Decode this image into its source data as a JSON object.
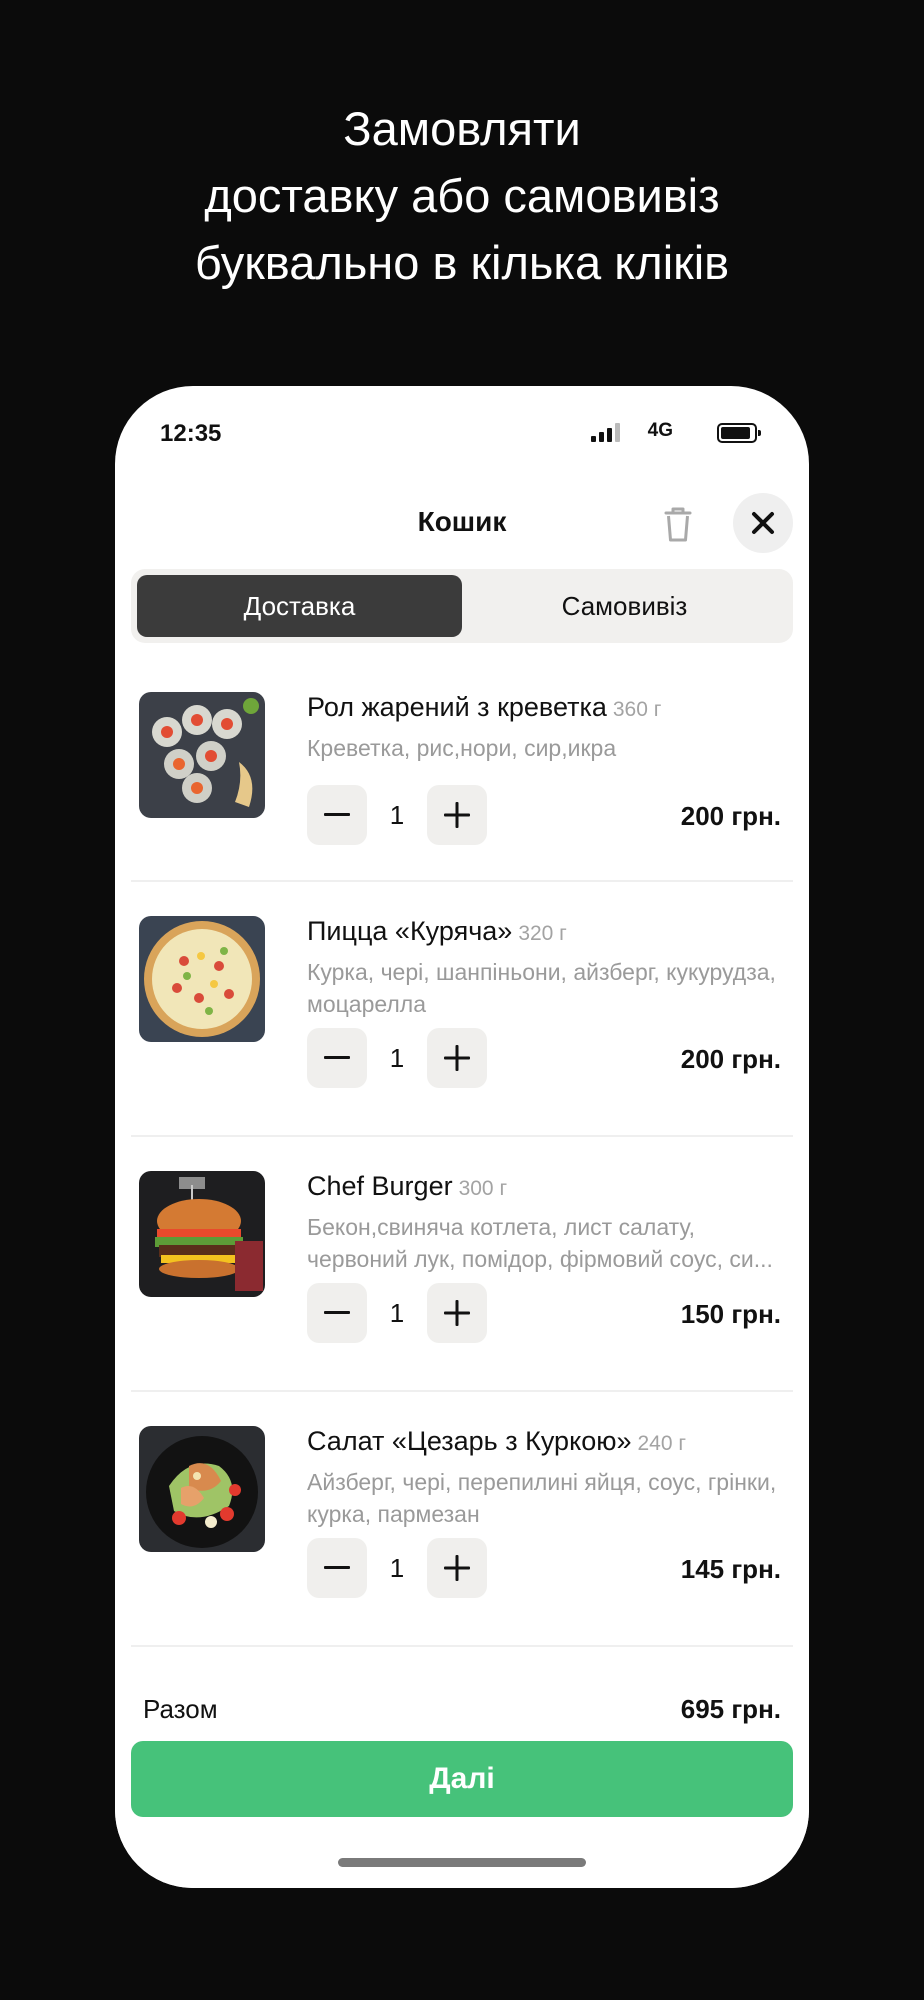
{
  "promo": {
    "line1": "Замовляти",
    "line2": "доставку або самовивіз",
    "line3": "буквально в кілька кліків"
  },
  "status_bar": {
    "time": "12:35",
    "network": "4G"
  },
  "header": {
    "title": "Кошик"
  },
  "tabs": {
    "delivery": "Доставка",
    "pickup": "Самовивіз",
    "selected": "Доставка"
  },
  "items": [
    {
      "name": "Рол жарений з креветка",
      "weight": "360 г",
      "desc": "Креветка, рис,нори, сир,икра",
      "qty": "1",
      "price": "200 грн."
    },
    {
      "name": "Пицца «Куряча»",
      "weight": "320 г",
      "desc": "Курка, черi, шанпiньони, айзберг, кукурудза, моцарелла",
      "qty": "1",
      "price": "200 грн."
    },
    {
      "name": "Chef Burger",
      "weight": "300 г",
      "desc": "Бекон,свиняча котлета, лист салату, червоний лук, помiдор, фiрмовий соус, си...",
      "qty": "1",
      "price": "150 грн."
    },
    {
      "name": "Салат «Цезарь з Куркою»",
      "weight": "240 г",
      "desc": "Айзберг, черi, перепилинi яйця, соус, грiнки, курка, пармезан",
      "qty": "1",
      "price": "145 грн."
    }
  ],
  "summary": {
    "total_label": "Разом",
    "total_value": "695 грн."
  },
  "actions": {
    "next_label": "Далі"
  },
  "colors": {
    "accent": "#46c27a",
    "active_tab": "#3b3b3b",
    "background": "#0b0b0b"
  }
}
